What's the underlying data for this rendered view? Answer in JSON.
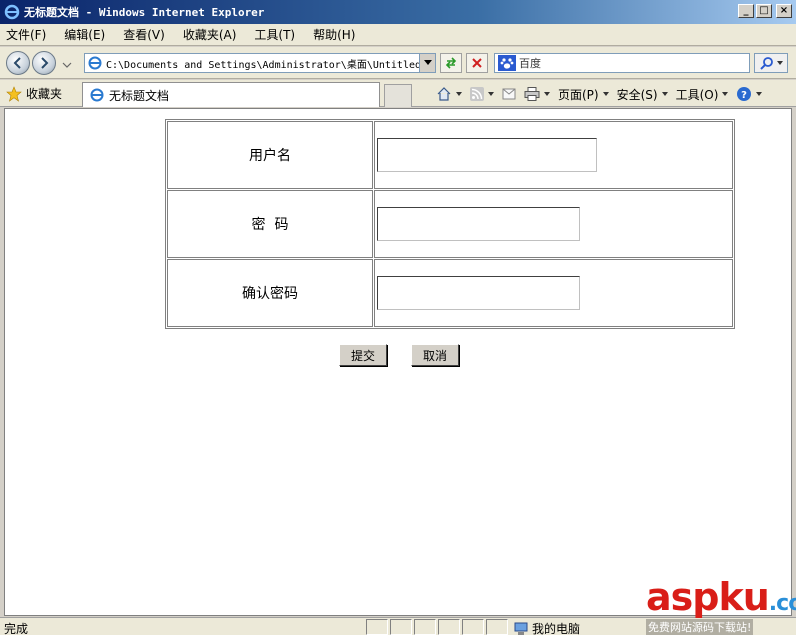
{
  "window": {
    "title": "无标题文档 - Windows Internet Explorer",
    "minimize_label": "_",
    "maximize_label": "□",
    "close_label": "×"
  },
  "menu": {
    "items": [
      "文件(F)",
      "编辑(E)",
      "查看(V)",
      "收藏夹(A)",
      "工具(T)",
      "帮助(H)"
    ]
  },
  "address_bar": {
    "url": "C:\\Documents and Settings\\Administrator\\桌面\\Untitled"
  },
  "search": {
    "placeholder": "百度"
  },
  "favorites": {
    "label": "收藏夹"
  },
  "tab": {
    "title": "无标题文档"
  },
  "command_bar": {
    "page_label": "页面(P)",
    "safety_label": "安全(S)",
    "tools_label": "工具(O)"
  },
  "form": {
    "rows": [
      {
        "label": "用户名"
      },
      {
        "label": "密  码"
      },
      {
        "label": "确认密码"
      }
    ],
    "submit_label": "提交",
    "cancel_label": "取消"
  },
  "status_bar": {
    "text": "完成",
    "zone": "我的电脑"
  },
  "watermark": {
    "logo_main": "aspku",
    "logo_suffix": ".com",
    "subtitle": "免费网站源码下载站!"
  },
  "colors": {
    "title_bar": "#0a246a",
    "chrome": "#ece9d8",
    "watermark_red": "#d91e18",
    "watermark_blue": "#2a8fd8"
  }
}
